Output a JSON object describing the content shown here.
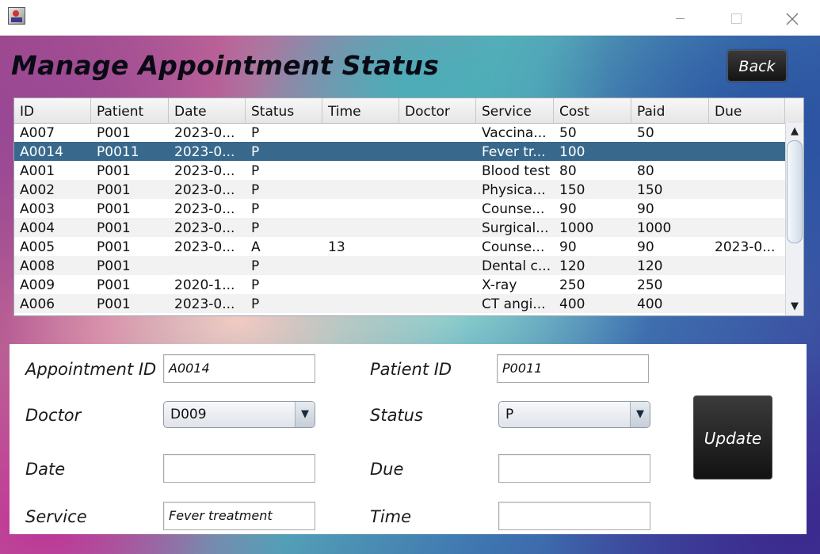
{
  "window": {
    "minimize_glyph": "",
    "maximize_glyph": "",
    "close_glyph": ""
  },
  "page": {
    "title": "Manage Appointment Status",
    "back_label": "Back"
  },
  "table": {
    "columns": [
      "ID",
      "Patient",
      "Date",
      "Status",
      "Time",
      "Doctor",
      "Service",
      "Cost",
      "Paid",
      "Due"
    ],
    "rows": [
      {
        "id": "A007",
        "patient": "P001",
        "date": "2023-0...",
        "status": "P",
        "time": "",
        "doctor": "",
        "service": "Vaccina...",
        "cost": "50",
        "paid": "50",
        "due": ""
      },
      {
        "id": "A0014",
        "patient": "P0011",
        "date": "2023-0...",
        "status": "P",
        "time": "",
        "doctor": "",
        "service": "Fever tr...",
        "cost": "100",
        "paid": "",
        "due": ""
      },
      {
        "id": "A001",
        "patient": "P001",
        "date": "2023-0...",
        "status": "P",
        "time": "",
        "doctor": "",
        "service": "Blood test",
        "cost": "80",
        "paid": "80",
        "due": ""
      },
      {
        "id": "A002",
        "patient": "P001",
        "date": "2023-0...",
        "status": "P",
        "time": "",
        "doctor": "",
        "service": "Physica...",
        "cost": "150",
        "paid": "150",
        "due": ""
      },
      {
        "id": "A003",
        "patient": "P001",
        "date": "2023-0...",
        "status": "P",
        "time": "",
        "doctor": "",
        "service": "Counse...",
        "cost": "90",
        "paid": "90",
        "due": ""
      },
      {
        "id": "A004",
        "patient": "P001",
        "date": "2023-0...",
        "status": "P",
        "time": "",
        "doctor": "",
        "service": "Surgical...",
        "cost": "1000",
        "paid": "1000",
        "due": ""
      },
      {
        "id": "A005",
        "patient": "P001",
        "date": "2023-0...",
        "status": "A",
        "time": "13",
        "doctor": "",
        "service": "Counse...",
        "cost": "90",
        "paid": "90",
        "due": "2023-0..."
      },
      {
        "id": "A008",
        "patient": "P001",
        "date": "",
        "status": "P",
        "time": "",
        "doctor": "",
        "service": "Dental c...",
        "cost": "120",
        "paid": "120",
        "due": ""
      },
      {
        "id": "A009",
        "patient": "P001",
        "date": "2020-1...",
        "status": "P",
        "time": "",
        "doctor": "",
        "service": "X-ray",
        "cost": "250",
        "paid": "250",
        "due": ""
      },
      {
        "id": "A006",
        "patient": "P001",
        "date": "2023-0...",
        "status": "P",
        "time": "",
        "doctor": "",
        "service": "CT angi...",
        "cost": "400",
        "paid": "400",
        "due": ""
      }
    ],
    "selected_row_index": 1
  },
  "form": {
    "appointment_id": {
      "label": "Appointment ID",
      "value": "A0014"
    },
    "patient_id": {
      "label": "Patient ID",
      "value": "P0011"
    },
    "doctor": {
      "label": "Doctor",
      "value": "D009"
    },
    "status": {
      "label": "Status",
      "value": "P"
    },
    "date": {
      "label": "Date",
      "value": ""
    },
    "due": {
      "label": "Due",
      "value": ""
    },
    "service": {
      "label": "Service",
      "value": "Fever treatment"
    },
    "time": {
      "label": "Time",
      "value": ""
    },
    "update_label": "Update"
  },
  "colors": {
    "selected_row": "#38698c",
    "button_dark": "#1a1a1a"
  }
}
